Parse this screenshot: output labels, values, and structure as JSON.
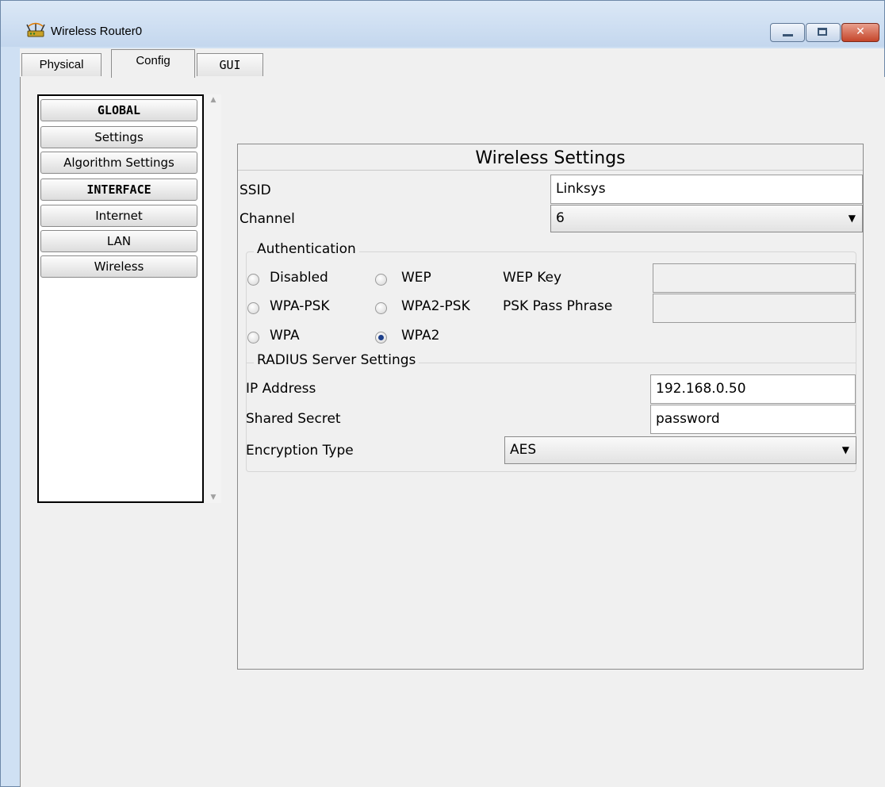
{
  "window": {
    "title": "Wireless Router0",
    "controls": {
      "minimize": "–",
      "maximize": "□",
      "close": "✕"
    }
  },
  "tabs": [
    {
      "label": "Physical",
      "active": false
    },
    {
      "label": "Config",
      "active": true
    },
    {
      "label": "GUI",
      "active": false
    }
  ],
  "nav": {
    "items": [
      {
        "label": "GLOBAL",
        "header": true
      },
      {
        "label": "Settings",
        "header": false
      },
      {
        "label": "Algorithm Settings",
        "header": false
      },
      {
        "label": "INTERFACE",
        "header": true
      },
      {
        "label": "Internet",
        "header": false
      },
      {
        "label": "LAN",
        "header": false
      },
      {
        "label": "Wireless",
        "header": false
      }
    ]
  },
  "panel": {
    "title": "Wireless Settings",
    "ssid": {
      "label": "SSID",
      "value": "Linksys"
    },
    "channel": {
      "label": "Channel",
      "value": "6"
    },
    "authentication": {
      "legend": "Authentication",
      "options": [
        {
          "label": "Disabled",
          "checked": false
        },
        {
          "label": "WEP",
          "checked": false
        },
        {
          "label": "WPA-PSK",
          "checked": false
        },
        {
          "label": "WPA2-PSK",
          "checked": false
        },
        {
          "label": "WPA",
          "checked": false
        },
        {
          "label": "WPA2",
          "checked": true
        }
      ],
      "wep_key": {
        "label": "WEP Key",
        "value": ""
      },
      "psk_pass_phrase": {
        "label": "PSK Pass Phrase",
        "value": ""
      }
    },
    "radius": {
      "legend": "RADIUS Server Settings",
      "ip_address": {
        "label": "IP Address",
        "value": "192.168.0.50"
      },
      "shared_secret": {
        "label": "Shared Secret",
        "value": "password"
      }
    },
    "encryption": {
      "label": "Encryption Type",
      "value": "AES"
    }
  },
  "colors": {
    "titlebar": "#c4d7ee",
    "close_button": "#c5452a",
    "radio_checked": "#1d3f8a"
  }
}
